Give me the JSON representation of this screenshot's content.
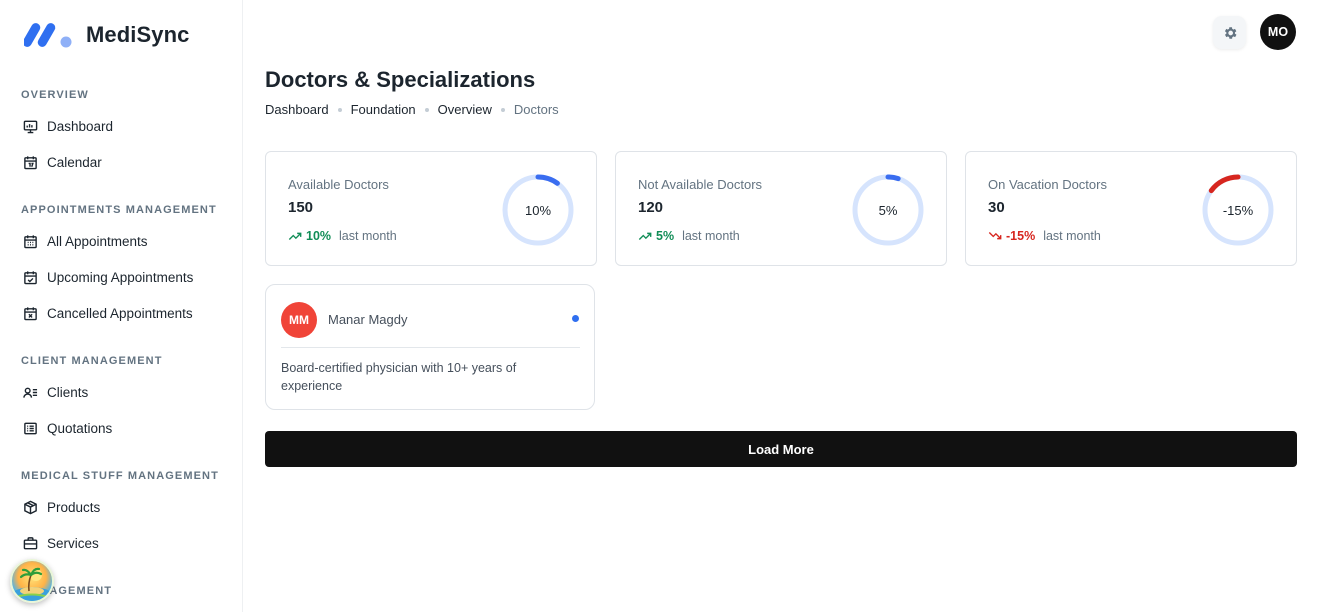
{
  "app": {
    "name": "MediSync"
  },
  "sidebar": {
    "sections": [
      {
        "title": "OVERVIEW",
        "items": [
          {
            "label": "Dashboard",
            "icon": "presentation-board-icon"
          },
          {
            "label": "Calendar",
            "icon": "calendar-icon"
          }
        ]
      },
      {
        "title": "APPOINTMENTS MANAGEMENT",
        "items": [
          {
            "label": "All Appointments",
            "icon": "calendar-grid-icon"
          },
          {
            "label": "Upcoming Appointments",
            "icon": "calendar-check-icon"
          },
          {
            "label": "Cancelled Appointments",
            "icon": "calendar-x-icon"
          }
        ]
      },
      {
        "title": "CLIENT MANAGEMENT",
        "items": [
          {
            "label": "Clients",
            "icon": "user-list-icon"
          },
          {
            "label": "Quotations",
            "icon": "document-list-icon"
          }
        ]
      },
      {
        "title": "MEDICAL STUFF MANAGEMENT",
        "items": [
          {
            "label": "Products",
            "icon": "box-icon"
          },
          {
            "label": "Services",
            "icon": "briefcase-icon"
          }
        ]
      },
      {
        "title": "MANAGEMENT",
        "items": []
      }
    ]
  },
  "header": {
    "settings_icon": "gear-icon",
    "avatar_initials": "MO"
  },
  "page": {
    "title": "Doctors & Specializations",
    "breadcrumb": [
      "Dashboard",
      "Foundation",
      "Overview",
      "Doctors"
    ]
  },
  "stats": [
    {
      "label": "Available Doctors",
      "value": "150",
      "trend": "10%",
      "direction": "up",
      "period": "last month",
      "ring_label": "10%",
      "ring_fraction": 0.1,
      "ring_color": "#3a6df0"
    },
    {
      "label": "Not Available Doctors",
      "value": "120",
      "trend": "5%",
      "direction": "up",
      "period": "last month",
      "ring_label": "5%",
      "ring_fraction": 0.05,
      "ring_color": "#3a6df0"
    },
    {
      "label": "On Vacation Doctors",
      "value": "30",
      "trend": "-15%",
      "direction": "down",
      "period": "last month",
      "ring_label": "-15%",
      "ring_fraction": 0.15,
      "ring_color": "#d7261f"
    }
  ],
  "doctors": [
    {
      "initials": "MM",
      "name": "Manar Magdy",
      "bio": "Board-certified physician with 10+ years of experience",
      "status_color": "#2f6ff0"
    }
  ],
  "load_more_label": "Load More",
  "colors": {
    "accent": "#3a6df0",
    "success": "#118d57",
    "danger": "#d7261f",
    "ring_track": "#d6e4fd"
  }
}
